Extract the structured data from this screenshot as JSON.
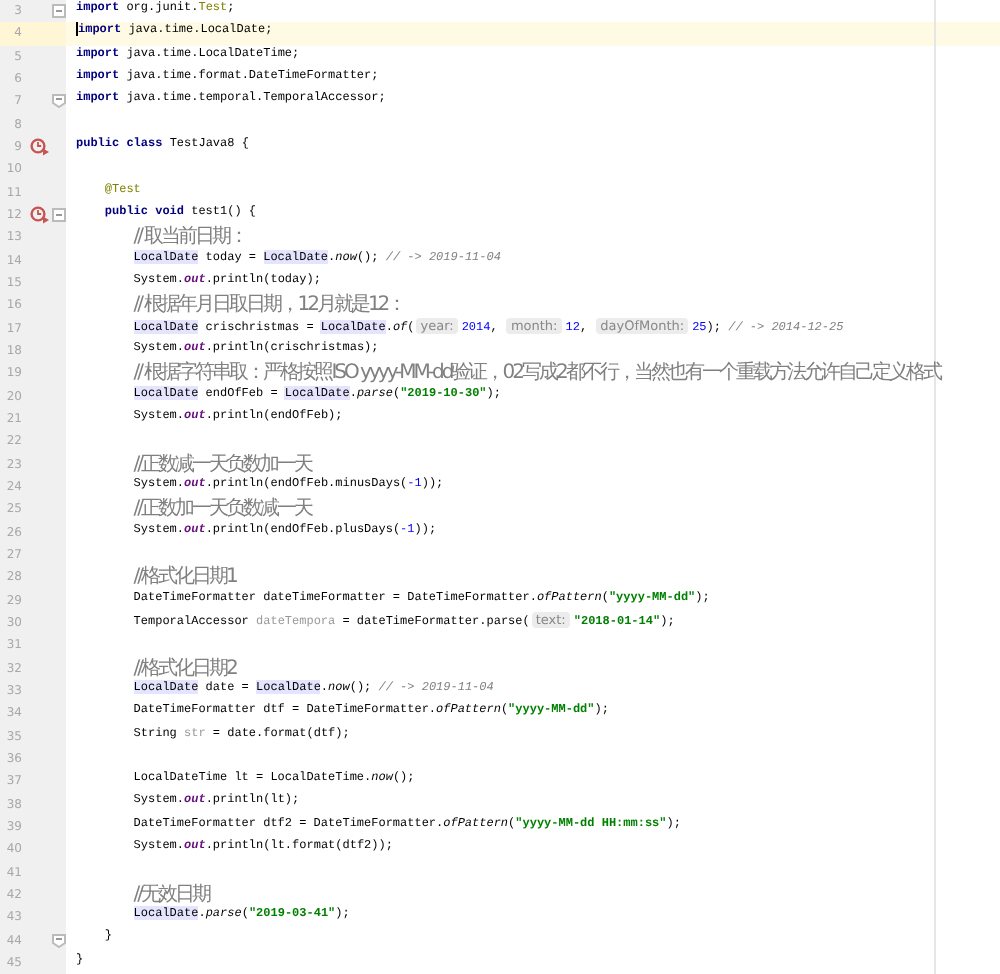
{
  "editor": {
    "lines": [
      {
        "number": "3",
        "current": false,
        "fold_start": true,
        "fold_end": false,
        "run_marker": false,
        "tokens": [
          {
            "kind": "kw",
            "text": "import"
          },
          {
            "kind": "plain",
            "text": " org.junit."
          },
          {
            "kind": "ann",
            "text": "Test"
          },
          {
            "kind": "plain",
            "text": ";"
          }
        ]
      },
      {
        "number": "4",
        "current": true,
        "fold_start": false,
        "fold_end": false,
        "run_marker": false,
        "tokens": [
          {
            "kind": "kw",
            "text": "import"
          },
          {
            "kind": "plain",
            "text": " java.time.LocalDate;"
          }
        ]
      },
      {
        "number": "5",
        "current": false,
        "fold_start": false,
        "fold_end": false,
        "run_marker": false,
        "tokens": [
          {
            "kind": "kw",
            "text": "import"
          },
          {
            "kind": "plain",
            "text": " java.time.LocalDateTime;"
          }
        ]
      },
      {
        "number": "6",
        "current": false,
        "fold_start": false,
        "fold_end": false,
        "run_marker": false,
        "tokens": [
          {
            "kind": "kw",
            "text": "import"
          },
          {
            "kind": "plain",
            "text": " java.time.format.DateTimeFormatter;"
          }
        ]
      },
      {
        "number": "7",
        "current": false,
        "fold_start": false,
        "fold_end": true,
        "run_marker": false,
        "tokens": [
          {
            "kind": "kw",
            "text": "import"
          },
          {
            "kind": "plain",
            "text": " java.time.temporal.TemporalAccessor;"
          }
        ]
      },
      {
        "number": "8",
        "current": false,
        "fold_start": false,
        "fold_end": false,
        "run_marker": false
      },
      {
        "number": "9",
        "current": false,
        "fold_start": false,
        "fold_end": false,
        "run_marker": true,
        "tokens": [
          {
            "kind": "kw",
            "text": "public class"
          },
          {
            "kind": "plain",
            "text": " TestJava8 {"
          }
        ],
        "children": [
          {
            "number": "10",
            "current": false,
            "fold_start": false,
            "fold_end": false,
            "run_marker": false
          },
          {
            "number": "11",
            "current": false,
            "fold_start": false,
            "fold_end": false,
            "run_marker": false,
            "tokens": [
              {
                "kind": "ann",
                "text": "@Test"
              }
            ]
          },
          {
            "number": "12",
            "current": false,
            "fold_start": true,
            "fold_end": false,
            "run_marker": true,
            "tokens": [
              {
                "kind": "kw",
                "text": "public void"
              },
              {
                "kind": "plain",
                "text": " test1() {"
              }
            ],
            "children": [
              {
                "number": "13",
                "current": false,
                "fold_start": false,
                "fold_end": false,
                "run_marker": false,
                "tokens": [
                  {
                    "kind": "note",
                    "text": "// 取当前日期："
                  }
                ]
              },
              {
                "number": "14",
                "current": false,
                "fold_start": false,
                "fold_end": false,
                "run_marker": false,
                "tokens": [
                  {
                    "kind": "hl",
                    "text": "LocalDate"
                  },
                  {
                    "kind": "plain",
                    "text": " today = "
                  },
                  {
                    "kind": "hl",
                    "text": "LocalDate"
                  },
                  {
                    "kind": "plain",
                    "text": "."
                  },
                  {
                    "kind": "static",
                    "text": "now"
                  },
                  {
                    "kind": "plain",
                    "text": "(); "
                  },
                  {
                    "kind": "comment",
                    "text": "// -> 2019-11-04"
                  }
                ]
              },
              {
                "number": "15",
                "current": false,
                "fold_start": false,
                "fold_end": false,
                "run_marker": false,
                "tokens": [
                  {
                    "kind": "plain",
                    "text": "System."
                  },
                  {
                    "kind": "field",
                    "text": "out"
                  },
                  {
                    "kind": "plain",
                    "text": ".println(today);"
                  }
                ]
              },
              {
                "number": "16",
                "current": false,
                "fold_start": false,
                "fold_end": false,
                "run_marker": false,
                "tokens": [
                  {
                    "kind": "note",
                    "text": "// 根据年月日取日期，12月就是12："
                  }
                ]
              },
              {
                "number": "17",
                "current": false,
                "fold_start": false,
                "fold_end": false,
                "run_marker": false,
                "tokens": [
                  {
                    "kind": "hl",
                    "text": "LocalDate"
                  },
                  {
                    "kind": "plain",
                    "text": " crischristmas = "
                  },
                  {
                    "kind": "hl",
                    "text": "LocalDate"
                  },
                  {
                    "kind": "plain",
                    "text": "."
                  },
                  {
                    "kind": "static",
                    "text": "of"
                  },
                  {
                    "kind": "plain",
                    "text": "("
                  },
                  {
                    "kind": "hint",
                    "text": "year:"
                  },
                  {
                    "kind": "num",
                    "text": "2014"
                  },
                  {
                    "kind": "plain",
                    "text": ", "
                  },
                  {
                    "kind": "hint",
                    "text": "month:"
                  },
                  {
                    "kind": "num",
                    "text": "12"
                  },
                  {
                    "kind": "plain",
                    "text": ", "
                  },
                  {
                    "kind": "hint",
                    "text": "dayOfMonth:"
                  },
                  {
                    "kind": "num",
                    "text": "25"
                  },
                  {
                    "kind": "plain",
                    "text": "); "
                  },
                  {
                    "kind": "comment",
                    "text": "// -> 2014-12-25"
                  }
                ]
              },
              {
                "number": "18",
                "current": false,
                "fold_start": false,
                "fold_end": false,
                "run_marker": false,
                "tokens": [
                  {
                    "kind": "plain",
                    "text": "System."
                  },
                  {
                    "kind": "field",
                    "text": "out"
                  },
                  {
                    "kind": "plain",
                    "text": ".println(crischristmas);"
                  }
                ]
              },
              {
                "number": "19",
                "current": false,
                "fold_start": false,
                "fold_end": false,
                "run_marker": false,
                "tokens": [
                  {
                    "kind": "note",
                    "text": "// 根据字符串取：严格按照ISO yyyy-MM-dd验证，02写成2都不行，当然也有一个重载方法允许自己定义格式"
                  }
                ]
              },
              {
                "number": "20",
                "current": false,
                "fold_start": false,
                "fold_end": false,
                "run_marker": false,
                "tokens": [
                  {
                    "kind": "hl",
                    "text": "LocalDate"
                  },
                  {
                    "kind": "plain",
                    "text": " endOfFeb = "
                  },
                  {
                    "kind": "hl",
                    "text": "LocalDate"
                  },
                  {
                    "kind": "plain",
                    "text": "."
                  },
                  {
                    "kind": "static",
                    "text": "parse"
                  },
                  {
                    "kind": "plain",
                    "text": "("
                  },
                  {
                    "kind": "str",
                    "text": "\"2019-10-30\""
                  },
                  {
                    "kind": "plain",
                    "text": ");"
                  }
                ]
              },
              {
                "number": "21",
                "current": false,
                "fold_start": false,
                "fold_end": false,
                "run_marker": false,
                "tokens": [
                  {
                    "kind": "plain",
                    "text": "System."
                  },
                  {
                    "kind": "field",
                    "text": "out"
                  },
                  {
                    "kind": "plain",
                    "text": ".println(endOfFeb);"
                  }
                ]
              },
              {
                "number": "22",
                "current": false,
                "fold_start": false,
                "fold_end": false,
                "run_marker": false
              },
              {
                "number": "23",
                "current": false,
                "fold_start": false,
                "fold_end": false,
                "run_marker": false,
                "tokens": [
                  {
                    "kind": "note",
                    "text": "//正数减一天负数加一天"
                  }
                ]
              },
              {
                "number": "24",
                "current": false,
                "fold_start": false,
                "fold_end": false,
                "run_marker": false,
                "tokens": [
                  {
                    "kind": "plain",
                    "text": "System."
                  },
                  {
                    "kind": "field",
                    "text": "out"
                  },
                  {
                    "kind": "plain",
                    "text": ".println(endOfFeb.minusDays("
                  },
                  {
                    "kind": "num",
                    "text": "-1"
                  },
                  {
                    "kind": "plain",
                    "text": "));"
                  }
                ]
              },
              {
                "number": "25",
                "current": false,
                "fold_start": false,
                "fold_end": false,
                "run_marker": false,
                "tokens": [
                  {
                    "kind": "note",
                    "text": "//正数加一天负数减一天"
                  }
                ]
              },
              {
                "number": "26",
                "current": false,
                "fold_start": false,
                "fold_end": false,
                "run_marker": false,
                "tokens": [
                  {
                    "kind": "plain",
                    "text": "System."
                  },
                  {
                    "kind": "field",
                    "text": "out"
                  },
                  {
                    "kind": "plain",
                    "text": ".println(endOfFeb.plusDays("
                  },
                  {
                    "kind": "num",
                    "text": "-1"
                  },
                  {
                    "kind": "plain",
                    "text": "));"
                  }
                ]
              },
              {
                "number": "27",
                "current": false,
                "fold_start": false,
                "fold_end": false,
                "run_marker": false
              },
              {
                "number": "28",
                "current": false,
                "fold_start": false,
                "fold_end": false,
                "run_marker": false,
                "tokens": [
                  {
                    "kind": "note",
                    "text": "//格式化日期1"
                  }
                ]
              },
              {
                "number": "29",
                "current": false,
                "fold_start": false,
                "fold_end": false,
                "run_marker": false,
                "tokens": [
                  {
                    "kind": "plain",
                    "text": "DateTimeFormatter dateTimeFormatter = DateTimeFormatter."
                  },
                  {
                    "kind": "static",
                    "text": "ofPattern"
                  },
                  {
                    "kind": "plain",
                    "text": "("
                  },
                  {
                    "kind": "str",
                    "text": "\"yyyy-MM-dd\""
                  },
                  {
                    "kind": "plain",
                    "text": ");"
                  }
                ]
              },
              {
                "number": "30",
                "current": false,
                "fold_start": false,
                "fold_end": false,
                "run_marker": false,
                "tokens": [
                  {
                    "kind": "plain",
                    "text": "TemporalAccessor "
                  },
                  {
                    "kind": "unused",
                    "text": "dateTempora"
                  },
                  {
                    "kind": "plain",
                    "text": " = dateTimeFormatter.parse("
                  },
                  {
                    "kind": "hint",
                    "text": "text:"
                  },
                  {
                    "kind": "str",
                    "text": "\"2018-01-14\""
                  },
                  {
                    "kind": "plain",
                    "text": ");"
                  }
                ]
              },
              {
                "number": "31",
                "current": false,
                "fold_start": false,
                "fold_end": false,
                "run_marker": false
              },
              {
                "number": "32",
                "current": false,
                "fold_start": false,
                "fold_end": false,
                "run_marker": false,
                "tokens": [
                  {
                    "kind": "note",
                    "text": "//格式化日期2"
                  }
                ]
              },
              {
                "number": "33",
                "current": false,
                "fold_start": false,
                "fold_end": false,
                "run_marker": false,
                "tokens": [
                  {
                    "kind": "hl",
                    "text": "LocalDate"
                  },
                  {
                    "kind": "plain",
                    "text": " date = "
                  },
                  {
                    "kind": "hl",
                    "text": "LocalDate"
                  },
                  {
                    "kind": "plain",
                    "text": "."
                  },
                  {
                    "kind": "static",
                    "text": "now"
                  },
                  {
                    "kind": "plain",
                    "text": "(); "
                  },
                  {
                    "kind": "comment",
                    "text": "// -> 2019-11-04"
                  }
                ]
              },
              {
                "number": "34",
                "current": false,
                "fold_start": false,
                "fold_end": false,
                "run_marker": false,
                "tokens": [
                  {
                    "kind": "plain",
                    "text": "DateTimeFormatter dtf = DateTimeFormatter."
                  },
                  {
                    "kind": "static",
                    "text": "ofPattern"
                  },
                  {
                    "kind": "plain",
                    "text": "("
                  },
                  {
                    "kind": "str",
                    "text": "\"yyyy-MM-dd\""
                  },
                  {
                    "kind": "plain",
                    "text": ");"
                  }
                ]
              },
              {
                "number": "35",
                "current": false,
                "fold_start": false,
                "fold_end": false,
                "run_marker": false,
                "tokens": [
                  {
                    "kind": "plain",
                    "text": "String "
                  },
                  {
                    "kind": "unused",
                    "text": "str"
                  },
                  {
                    "kind": "plain",
                    "text": " = date.format(dtf);"
                  }
                ]
              },
              {
                "number": "36",
                "current": false,
                "fold_start": false,
                "fold_end": false,
                "run_marker": false
              },
              {
                "number": "37",
                "current": false,
                "fold_start": false,
                "fold_end": false,
                "run_marker": false,
                "tokens": [
                  {
                    "kind": "plain",
                    "text": "LocalDateTime lt = LocalDateTime."
                  },
                  {
                    "kind": "static",
                    "text": "now"
                  },
                  {
                    "kind": "plain",
                    "text": "();"
                  }
                ]
              },
              {
                "number": "38",
                "current": false,
                "fold_start": false,
                "fold_end": false,
                "run_marker": false,
                "tokens": [
                  {
                    "kind": "plain",
                    "text": "System."
                  },
                  {
                    "kind": "field",
                    "text": "out"
                  },
                  {
                    "kind": "plain",
                    "text": ".println(lt);"
                  }
                ]
              },
              {
                "number": "39",
                "current": false,
                "fold_start": false,
                "fold_end": false,
                "run_marker": false,
                "tokens": [
                  {
                    "kind": "plain",
                    "text": "DateTimeFormatter dtf2 = DateTimeFormatter."
                  },
                  {
                    "kind": "static",
                    "text": "ofPattern"
                  },
                  {
                    "kind": "plain",
                    "text": "("
                  },
                  {
                    "kind": "str",
                    "text": "\"yyyy-MM-dd HH:mm:ss\""
                  },
                  {
                    "kind": "plain",
                    "text": ");"
                  }
                ]
              },
              {
                "number": "40",
                "current": false,
                "fold_start": false,
                "fold_end": false,
                "run_marker": false,
                "tokens": [
                  {
                    "kind": "plain",
                    "text": "System."
                  },
                  {
                    "kind": "field",
                    "text": "out"
                  },
                  {
                    "kind": "plain",
                    "text": ".println(lt.format(dtf2));"
                  }
                ]
              },
              {
                "number": "41",
                "current": false,
                "fold_start": false,
                "fold_end": false,
                "run_marker": false
              },
              {
                "number": "42",
                "current": false,
                "fold_start": false,
                "fold_end": false,
                "run_marker": false,
                "tokens": [
                  {
                    "kind": "note",
                    "text": "//无效日期"
                  }
                ]
              },
              {
                "number": "43",
                "current": false,
                "fold_start": false,
                "fold_end": false,
                "run_marker": false,
                "tokens": [
                  {
                    "kind": "hl",
                    "text": "LocalDate"
                  },
                  {
                    "kind": "plain",
                    "text": "."
                  },
                  {
                    "kind": "static",
                    "text": "parse"
                  },
                  {
                    "kind": "plain",
                    "text": "("
                  },
                  {
                    "kind": "str",
                    "text": "\"2019-03-41\""
                  },
                  {
                    "kind": "plain",
                    "text": ");"
                  }
                ]
              }
            ]
          },
          {
            "number": "44",
            "current": false,
            "fold_start": false,
            "fold_end": true,
            "run_marker": false,
            "tokens": [
              {
                "kind": "plain",
                "text": "}"
              }
            ]
          }
        ]
      },
      {
        "number": "45",
        "current": false,
        "fold_start": false,
        "fold_end": false,
        "run_marker": false,
        "tokens": [
          {
            "kind": "plain",
            "text": "}"
          }
        ]
      }
    ]
  }
}
